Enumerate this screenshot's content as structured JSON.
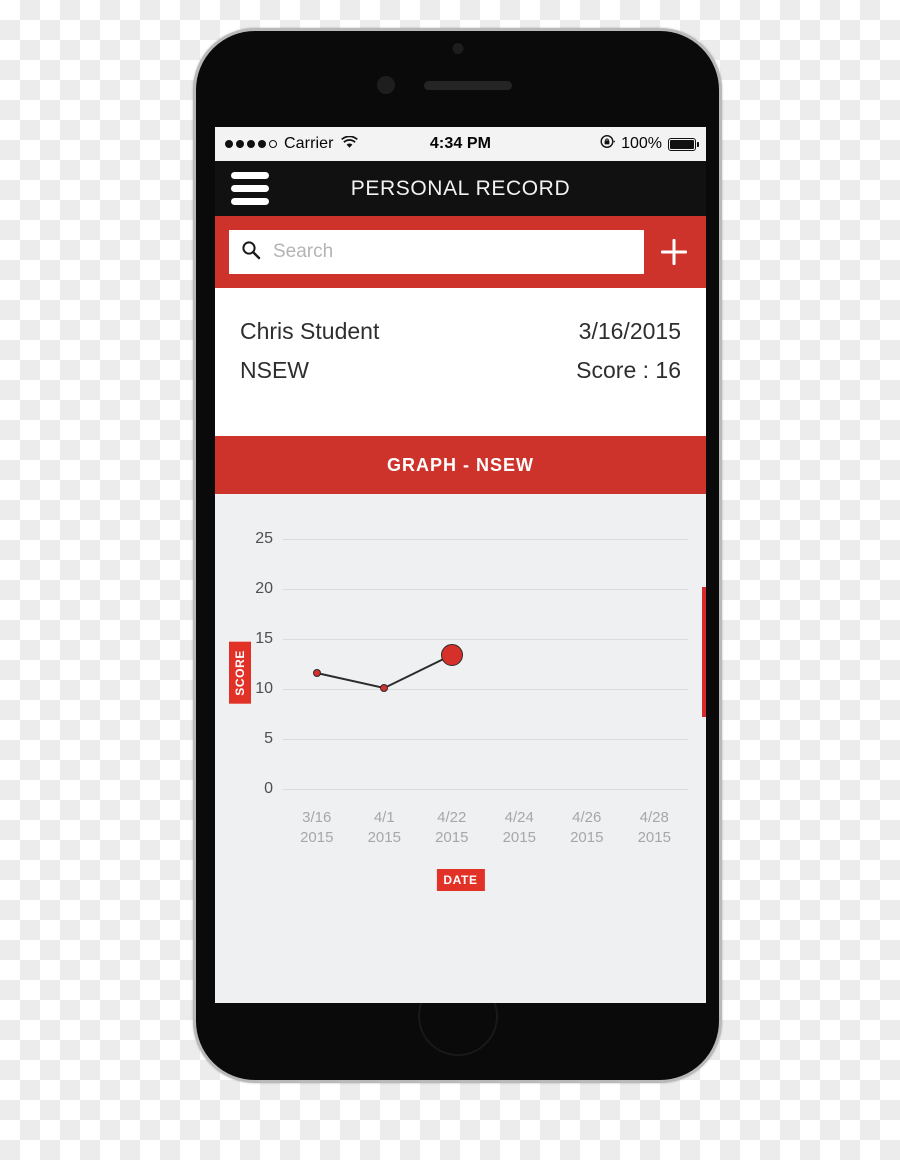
{
  "status_bar": {
    "carrier": "Carrier",
    "signal_dots_filled": 4,
    "signal_dots_total": 5,
    "wifi_icon": "wifi-icon",
    "time": "4:34 PM",
    "rotation_lock_icon": "rotation-lock-icon",
    "battery_percent": "100%",
    "battery_icon": "battery-full-icon"
  },
  "nav_bar": {
    "menu_icon": "hamburger-menu-icon",
    "title": "PERSONAL RECORD"
  },
  "search": {
    "placeholder": "Search",
    "value": "",
    "icon": "search-icon",
    "add_icon": "plus-icon"
  },
  "record": {
    "name": "Chris Student",
    "date": "3/16/2015",
    "category": "NSEW",
    "score_label": "Score : 16"
  },
  "graph_header": {
    "title": "GRAPH - NSEW"
  },
  "colors": {
    "brand_red": "#cd332b",
    "badge_red": "#e23228",
    "nav_black": "#111111",
    "chart_bg": "#eff0f2",
    "point_red": "#d6302a",
    "gridline": "#dcdcdc"
  },
  "chart_data": {
    "type": "line",
    "title": "GRAPH - NSEW",
    "xlabel": "DATE",
    "ylabel": "SCORE",
    "categories": [
      "3/16\n2015",
      "4/1\n2015",
      "4/22\n2015",
      "4/24\n2015",
      "4/26\n2015",
      "4/28\n2015"
    ],
    "x_tick_labels": [
      {
        "line1": "3/16",
        "line2": "2015"
      },
      {
        "line1": "4/1",
        "line2": "2015"
      },
      {
        "line1": "4/22",
        "line2": "2015"
      },
      {
        "line1": "4/24",
        "line2": "2015"
      },
      {
        "line1": "4/26",
        "line2": "2015"
      },
      {
        "line1": "4/28",
        "line2": "2015"
      }
    ],
    "y_tick_labels": [
      "25",
      "20",
      "15",
      "10",
      "5",
      "0"
    ],
    "y_ticks": [
      25,
      20,
      15,
      10,
      5,
      0
    ],
    "ylim": [
      0,
      25
    ],
    "grid": true,
    "legend": "none",
    "series": [
      {
        "name": "SCORE",
        "values": [
          11.6,
          10.1,
          13.4,
          null,
          null,
          null
        ],
        "point_sizes": [
          8,
          8,
          22
        ]
      }
    ]
  }
}
